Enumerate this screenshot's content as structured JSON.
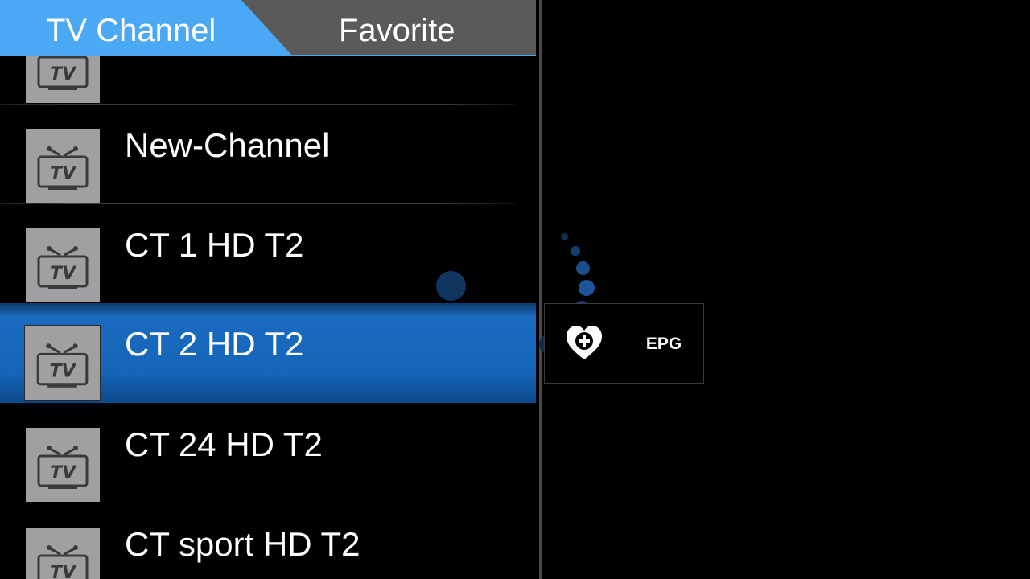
{
  "tabs": [
    {
      "label": "TV Channel",
      "active": true
    },
    {
      "label": "Favorite",
      "active": false
    }
  ],
  "channels": [
    {
      "name": "",
      "thumbnail_icon": "tv-icon",
      "selected": false
    },
    {
      "name": "New-Channel",
      "thumbnail_icon": "tv-icon",
      "selected": false
    },
    {
      "name": "CT 1 HD T2",
      "thumbnail_icon": "tv-icon",
      "selected": false
    },
    {
      "name": "CT 2 HD T2",
      "thumbnail_icon": "tv-icon",
      "selected": true
    },
    {
      "name": "CT 24 HD T2",
      "thumbnail_icon": "tv-icon",
      "selected": false
    },
    {
      "name": "CT sport HD T2",
      "thumbnail_icon": "tv-icon",
      "selected": false
    }
  ],
  "actions": {
    "add_favorite_icon": "heart-plus-icon",
    "epg_label": "EPG"
  },
  "loading_indicator_icon": "loading-spinner-icon",
  "colors": {
    "accent": "#4aa8f5",
    "tab_inactive": "#5a5a5a",
    "selected_row": "#1565b8",
    "thumbnail_bg": "#a0a0a0"
  }
}
